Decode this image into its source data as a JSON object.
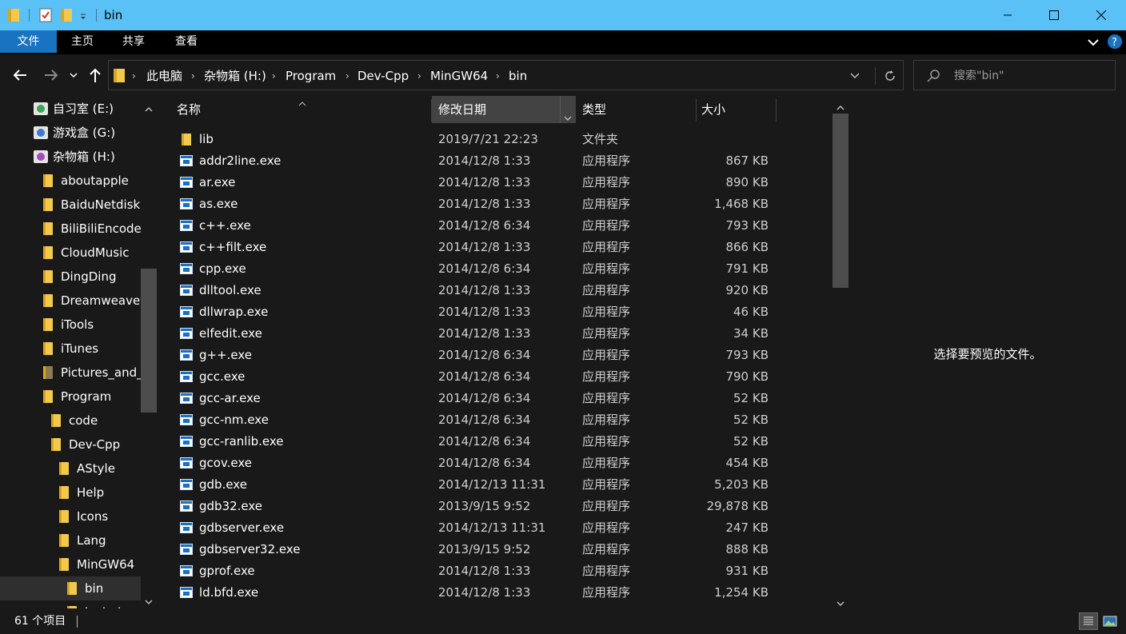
{
  "window": {
    "title": "bin"
  },
  "ribbon": {
    "tabs": [
      {
        "label": "文件"
      },
      {
        "label": "主页"
      },
      {
        "label": "共享"
      },
      {
        "label": "查看"
      }
    ]
  },
  "address": {
    "crumbs": [
      {
        "label": "此电脑"
      },
      {
        "label": "杂物箱 (H:)"
      },
      {
        "label": "Program"
      },
      {
        "label": "Dev-Cpp"
      },
      {
        "label": "MinGW64"
      },
      {
        "label": "bin"
      }
    ]
  },
  "search": {
    "placeholder": "搜索\"bin\""
  },
  "tree": {
    "items": [
      {
        "label": "自习室 (E:)"
      },
      {
        "label": "游戏盒 (G:)"
      },
      {
        "label": "杂物箱 (H:)"
      },
      {
        "label": "aboutapple"
      },
      {
        "label": "BaiduNetdisk"
      },
      {
        "label": "BiliBiliEncoder"
      },
      {
        "label": "CloudMusic"
      },
      {
        "label": "DingDing"
      },
      {
        "label": "Dreamweaver"
      },
      {
        "label": "iTools"
      },
      {
        "label": "iTunes"
      },
      {
        "label": "Pictures_and_"
      },
      {
        "label": "Program"
      },
      {
        "label": "code"
      },
      {
        "label": "Dev-Cpp"
      },
      {
        "label": "AStyle"
      },
      {
        "label": "Help"
      },
      {
        "label": "Icons"
      },
      {
        "label": "Lang"
      },
      {
        "label": "MinGW64"
      },
      {
        "label": "bin"
      },
      {
        "label": "include"
      }
    ]
  },
  "list": {
    "columns": [
      {
        "label": "名称"
      },
      {
        "label": "修改日期"
      },
      {
        "label": "类型"
      },
      {
        "label": "大小"
      }
    ],
    "rows": [
      {
        "name": "lib",
        "date": "2019/7/21 22:23",
        "type": "文件夹",
        "size": ""
      },
      {
        "name": "addr2line.exe",
        "date": "2014/12/8 1:33",
        "type": "应用程序",
        "size": "867 KB"
      },
      {
        "name": "ar.exe",
        "date": "2014/12/8 1:33",
        "type": "应用程序",
        "size": "890 KB"
      },
      {
        "name": "as.exe",
        "date": "2014/12/8 1:33",
        "type": "应用程序",
        "size": "1,468 KB"
      },
      {
        "name": "c++.exe",
        "date": "2014/12/8 6:34",
        "type": "应用程序",
        "size": "793 KB"
      },
      {
        "name": "c++filt.exe",
        "date": "2014/12/8 1:33",
        "type": "应用程序",
        "size": "866 KB"
      },
      {
        "name": "cpp.exe",
        "date": "2014/12/8 6:34",
        "type": "应用程序",
        "size": "791 KB"
      },
      {
        "name": "dlltool.exe",
        "date": "2014/12/8 1:33",
        "type": "应用程序",
        "size": "920 KB"
      },
      {
        "name": "dllwrap.exe",
        "date": "2014/12/8 1:33",
        "type": "应用程序",
        "size": "46 KB"
      },
      {
        "name": "elfedit.exe",
        "date": "2014/12/8 1:33",
        "type": "应用程序",
        "size": "34 KB"
      },
      {
        "name": "g++.exe",
        "date": "2014/12/8 6:34",
        "type": "应用程序",
        "size": "793 KB"
      },
      {
        "name": "gcc.exe",
        "date": "2014/12/8 6:34",
        "type": "应用程序",
        "size": "790 KB"
      },
      {
        "name": "gcc-ar.exe",
        "date": "2014/12/8 6:34",
        "type": "应用程序",
        "size": "52 KB"
      },
      {
        "name": "gcc-nm.exe",
        "date": "2014/12/8 6:34",
        "type": "应用程序",
        "size": "52 KB"
      },
      {
        "name": "gcc-ranlib.exe",
        "date": "2014/12/8 6:34",
        "type": "应用程序",
        "size": "52 KB"
      },
      {
        "name": "gcov.exe",
        "date": "2014/12/8 6:34",
        "type": "应用程序",
        "size": "454 KB"
      },
      {
        "name": "gdb.exe",
        "date": "2014/12/13 11:31",
        "type": "应用程序",
        "size": "5,203 KB"
      },
      {
        "name": "gdb32.exe",
        "date": "2013/9/15 9:52",
        "type": "应用程序",
        "size": "29,878 KB"
      },
      {
        "name": "gdbserver.exe",
        "date": "2014/12/13 11:31",
        "type": "应用程序",
        "size": "247 KB"
      },
      {
        "name": "gdbserver32.exe",
        "date": "2013/9/15 9:52",
        "type": "应用程序",
        "size": "888 KB"
      },
      {
        "name": "gprof.exe",
        "date": "2014/12/8 1:33",
        "type": "应用程序",
        "size": "931 KB"
      },
      {
        "name": "ld.bfd.exe",
        "date": "2014/12/8 1:33",
        "type": "应用程序",
        "size": "1,254 KB"
      }
    ]
  },
  "preview": {
    "message": "选择要预览的文件。"
  },
  "status": {
    "count": "61 个项目"
  },
  "colors": {
    "titlebar": "#5ac1f7",
    "ribbon_active": "#1a73c1",
    "background": "#191919",
    "folder": "#f2c94c"
  }
}
